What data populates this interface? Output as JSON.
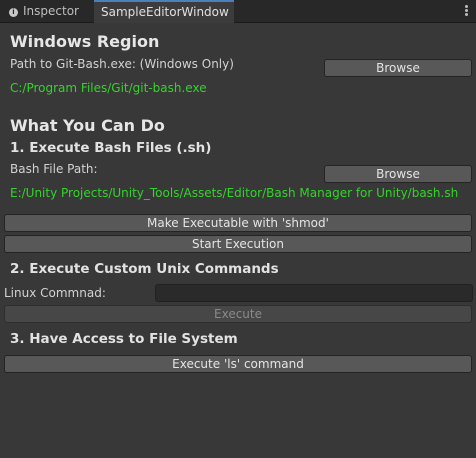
{
  "tabs": [
    {
      "label": "Inspector",
      "icon": "info-icon"
    },
    {
      "label": "SampleEditorWindow"
    }
  ],
  "windows_region": {
    "title": "Windows Region",
    "path_label": "Path to Git-Bash.exe: (Windows Only)",
    "browse_label": "Browse",
    "path_value": "C:/Program Files/Git/git-bash.exe"
  },
  "what_you_can_do": {
    "title": "What You Can Do"
  },
  "section1": {
    "title": "1. Execute Bash Files (.sh)",
    "path_label": "Bash File Path:",
    "browse_label": "Browse",
    "path_value": "E:/Unity Projects/Unity_Tools/Assets/Editor/Bash Manager for Unity/bash.sh",
    "make_exec_label": "Make Executable with 'shmod'",
    "start_exec_label": "Start Execution"
  },
  "section2": {
    "title": "2. Execute Custom Unix Commands",
    "command_label": "Linux Commnad:",
    "command_value": "",
    "execute_label": "Execute"
  },
  "section3": {
    "title": "3. Have Access to File System",
    "ls_label": "Execute 'ls' command"
  },
  "colors": {
    "background": "#383838",
    "path_text": "#33d42a",
    "tab_accent": "#4b7fbe"
  }
}
